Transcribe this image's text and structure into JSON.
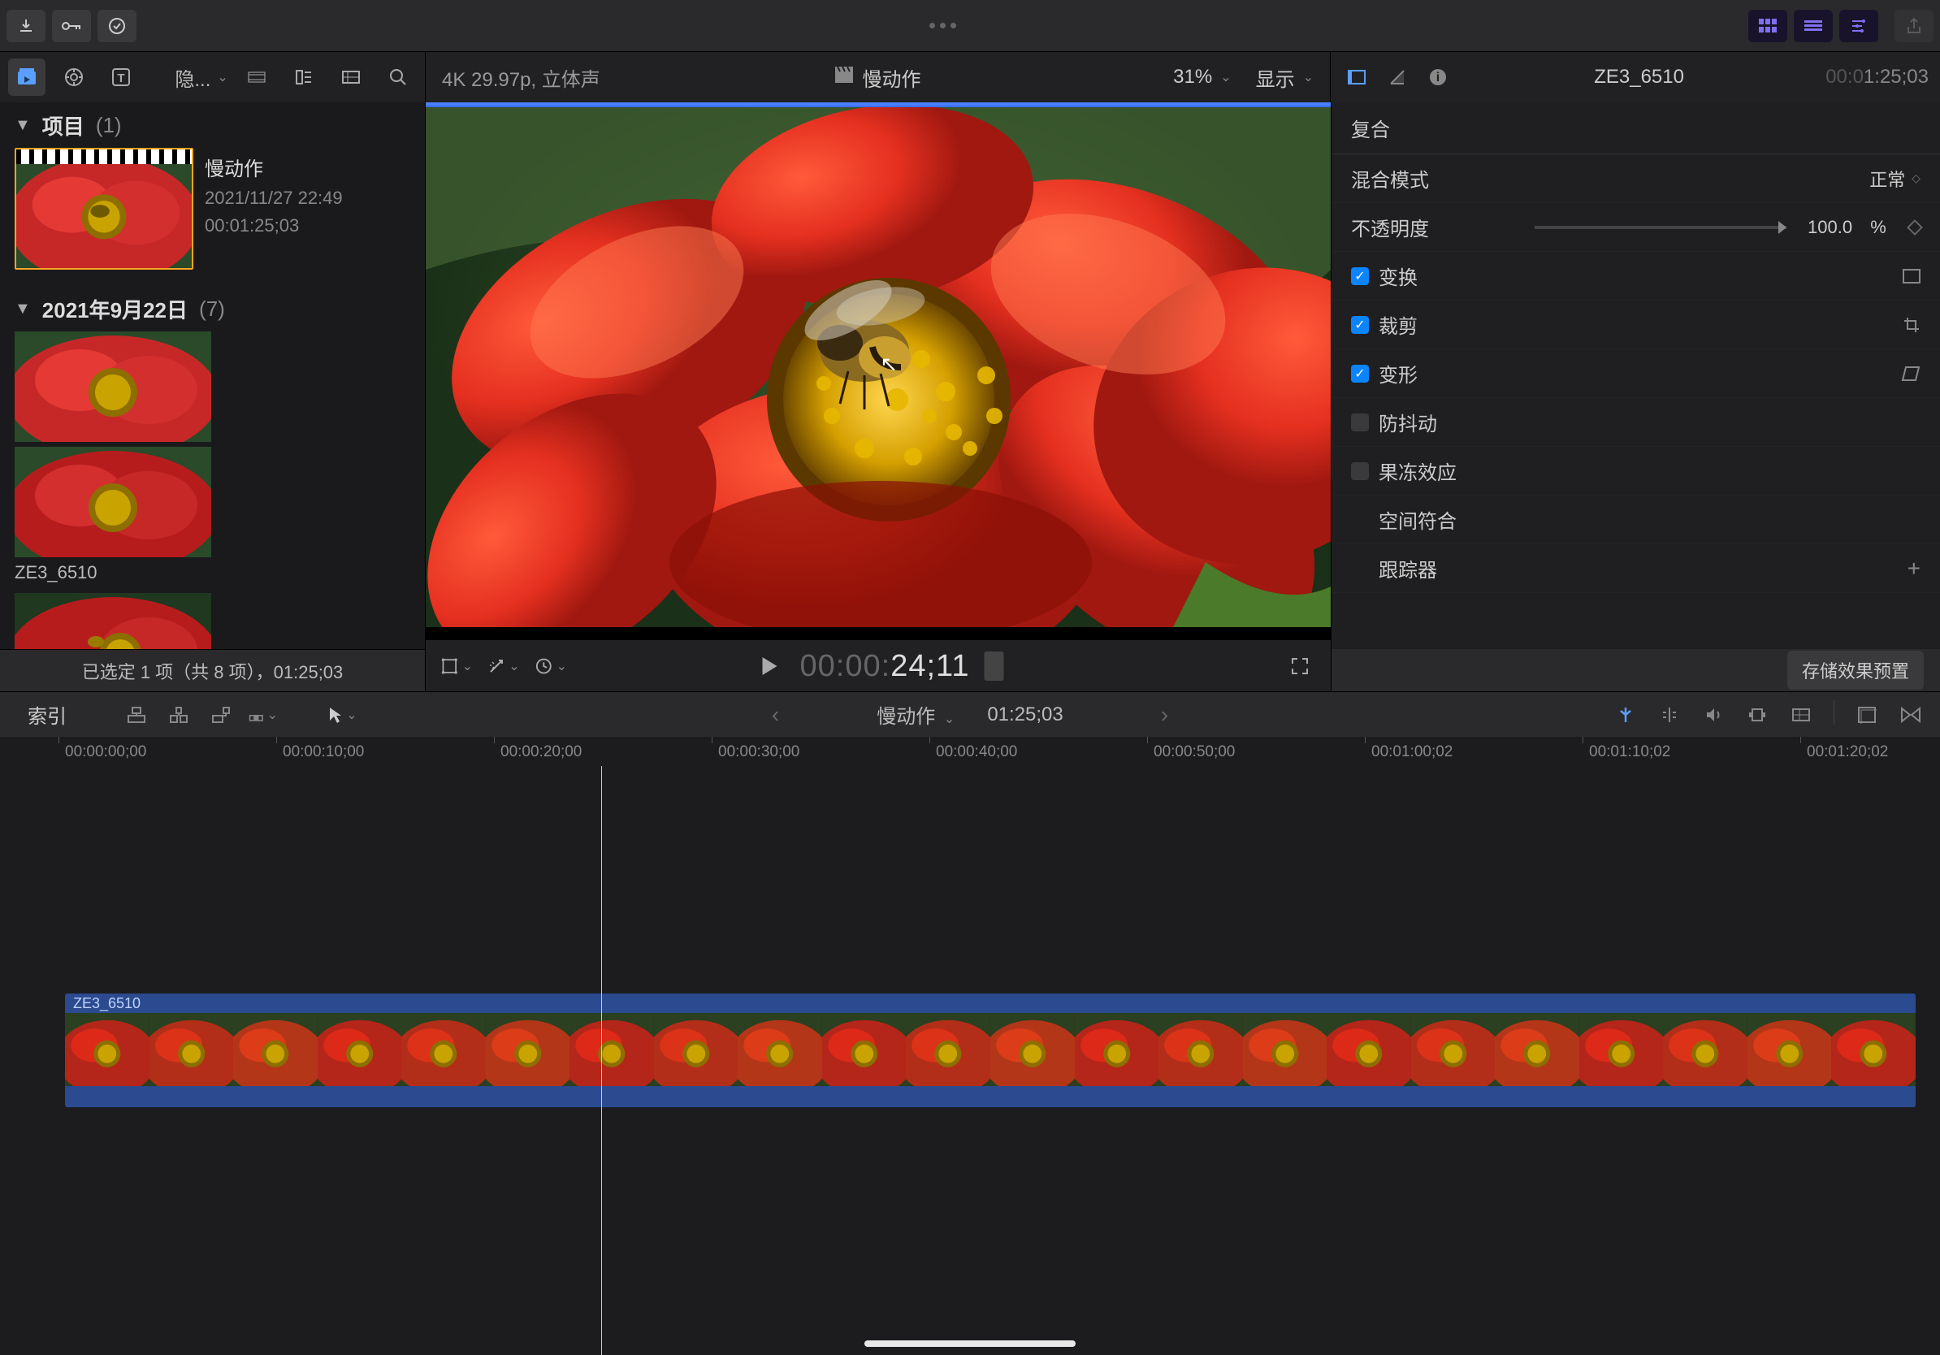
{
  "toolbar": {
    "download": "↓",
    "key": "⚿",
    "check": "✓"
  },
  "secondary": {
    "hide_label": "隐...",
    "video_info": "4K 29.97p, 立体声",
    "project_name": "慢动作",
    "zoom_percent": "31%",
    "display_label": "显示"
  },
  "inspector_header": {
    "clip_name": "ZE3_6510",
    "duration_prefix": "00:0",
    "duration": "1:25;03"
  },
  "library": {
    "projects_header": "项目",
    "projects_count": "(1)",
    "project": {
      "title": "慢动作",
      "date": "2021/11/27 22:49",
      "duration": "00:01:25;03"
    },
    "event_header": "2021年9月22日",
    "event_count": "(7)",
    "clip_label": "ZE3_6510",
    "footer": "已选定 1 项（共 8 项），01:25;03"
  },
  "transport": {
    "timecode_dim": "00:00:",
    "timecode": "24;11"
  },
  "inspector": {
    "section_composite": "复合",
    "blend_mode_label": "混合模式",
    "blend_mode_value": "正常",
    "opacity_label": "不透明度",
    "opacity_value": "100.0",
    "opacity_unit": "%",
    "transform_label": "变换",
    "crop_label": "裁剪",
    "distort_label": "变形",
    "stabilize_label": "防抖动",
    "rolling_label": "果冻效应",
    "spatial_label": "空间符合",
    "tracker_label": "跟踪器",
    "save_preset": "存储效果预置"
  },
  "timeline_bar": {
    "index_label": "索引",
    "project_name": "慢动作",
    "duration": "01:25;03"
  },
  "ruler": {
    "marks": [
      "00:00:00;00",
      "00:00:10;00",
      "00:00:20;00",
      "00:00:30;00",
      "00:00:40;00",
      "00:00:50;00",
      "00:01:00;02",
      "00:01:10;02",
      "00:01:20;02"
    ]
  },
  "timeline": {
    "clip_name": "ZE3_6510"
  }
}
